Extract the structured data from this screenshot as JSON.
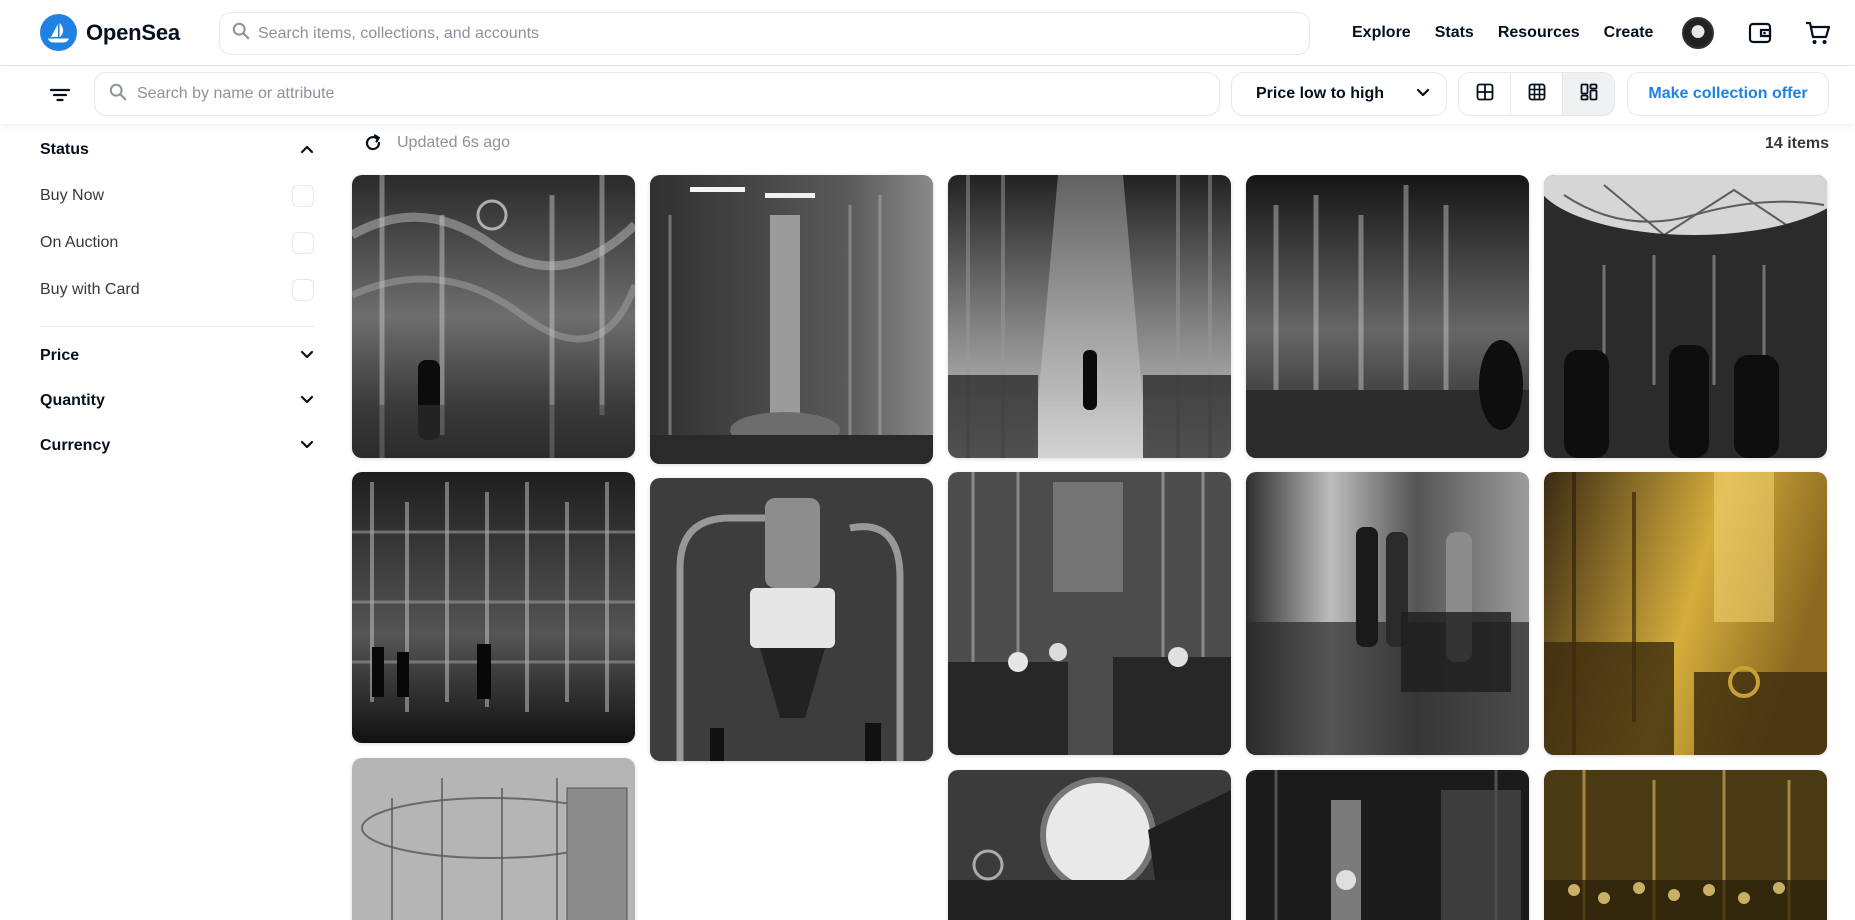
{
  "nav": {
    "brand": "OpenSea",
    "search_placeholder": "Search items, collections, and accounts",
    "links": [
      "Explore",
      "Stats",
      "Resources",
      "Create"
    ]
  },
  "toolbar": {
    "search_placeholder": "Search by name or attribute",
    "sort_value": "Price low to high",
    "offer_label": "Make collection offer"
  },
  "sidebar": {
    "status_title": "Status",
    "status_options": [
      "Buy Now",
      "On Auction",
      "Buy with Card"
    ],
    "sections": [
      "Price",
      "Quantity",
      "Currency"
    ]
  },
  "results": {
    "updated": "Updated 6s ago",
    "count": "14 items"
  },
  "colors": {
    "brand": "#2081e2",
    "text": "#04111d",
    "muted": "#8a939b",
    "border": "#e5e8eb"
  }
}
